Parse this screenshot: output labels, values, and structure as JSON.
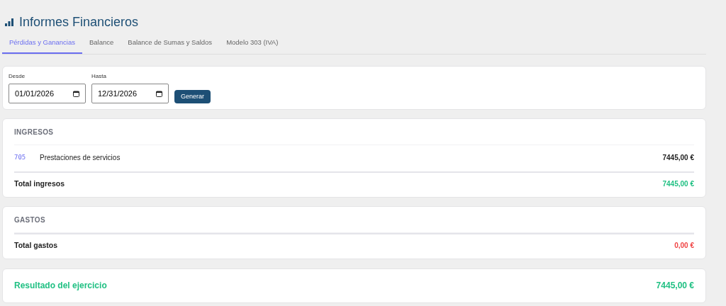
{
  "header": {
    "title": "Informes Financieros"
  },
  "tabs": [
    {
      "label": "Pérdidas y Ganancias",
      "selected": true
    },
    {
      "label": "Balance",
      "selected": false
    },
    {
      "label": "Balance de Sumas y Saldos",
      "selected": false
    },
    {
      "label": "Modelo 303 (IVA)",
      "selected": false
    }
  ],
  "filters": {
    "fields": [
      {
        "label": "Desde",
        "value": "01/01/2026"
      },
      {
        "label": "Hasta",
        "value": "12/31/2026"
      }
    ],
    "button": "Generar"
  },
  "sections": [
    {
      "title": "INGRESOS",
      "rows": [
        {
          "code": "705",
          "name": "Prestaciones de servicios",
          "amount": "7445,00 €"
        }
      ],
      "total_label": "Total ingresos",
      "total": "7445,00 €",
      "color": "#20c083"
    },
    {
      "title": "GASTOS",
      "total_label": "Total gastos",
      "total": "0,00 €",
      "color": "#f04444"
    }
  ],
  "result": {
    "label": "Resultado del ejercicio",
    "amount": "7445,00 €"
  }
}
